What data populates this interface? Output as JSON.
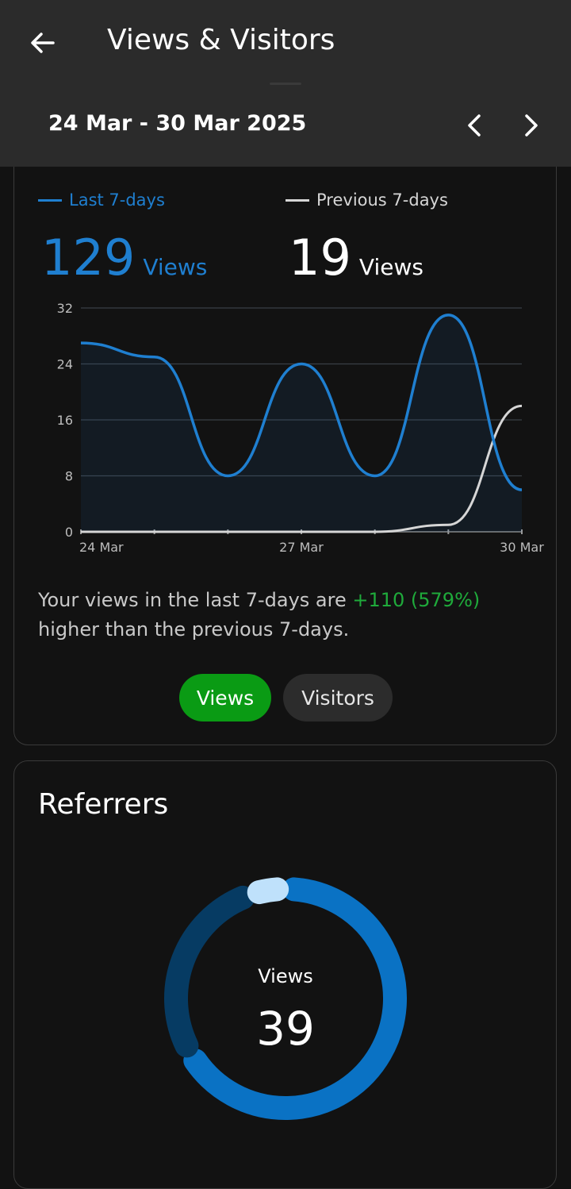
{
  "header": {
    "title": "Views & Visitors",
    "date_range": "24 Mar - 30 Mar 2025"
  },
  "legend": {
    "current_label": "Last 7-days",
    "previous_label": "Previous 7-days"
  },
  "stats": {
    "current_value": "129",
    "current_unit": "Views",
    "previous_value": "19",
    "previous_unit": "Views"
  },
  "colors": {
    "current": "#1f7fd0",
    "previous": "#d6d6d6",
    "positive": "#1faa3b",
    "toggle_active": "#0a9b14"
  },
  "chart_data": {
    "type": "line",
    "x": [
      "24 Mar",
      "25 Mar",
      "26 Mar",
      "27 Mar",
      "28 Mar",
      "29 Mar",
      "30 Mar"
    ],
    "x_tick_labels": [
      "24 Mar",
      "27 Mar",
      "30 Mar"
    ],
    "y_ticks": [
      "0",
      "8",
      "16",
      "24",
      "32"
    ],
    "ylim": [
      0,
      32
    ],
    "grid": true,
    "series": [
      {
        "name": "Last 7-days",
        "values": [
          27,
          25,
          8,
          24,
          8,
          31,
          6
        ]
      },
      {
        "name": "Previous 7-days",
        "values": [
          0,
          0,
          0,
          0,
          0,
          1,
          18
        ]
      }
    ]
  },
  "summary": {
    "prefix": "Your views in the last 7-days are ",
    "delta": "+110 (579%)",
    "suffix": "higher than the previous 7-days."
  },
  "toggle": {
    "views_label": "Views",
    "visitors_label": "Visitors"
  },
  "referrers": {
    "title": "Referrers",
    "center_label": "Views",
    "center_value": "39",
    "segments": [
      {
        "value": 26,
        "color": "#0a72c4"
      },
      {
        "value": 11,
        "color": "#063b63"
      },
      {
        "value": 2,
        "color": "#bfe1fb"
      }
    ]
  }
}
